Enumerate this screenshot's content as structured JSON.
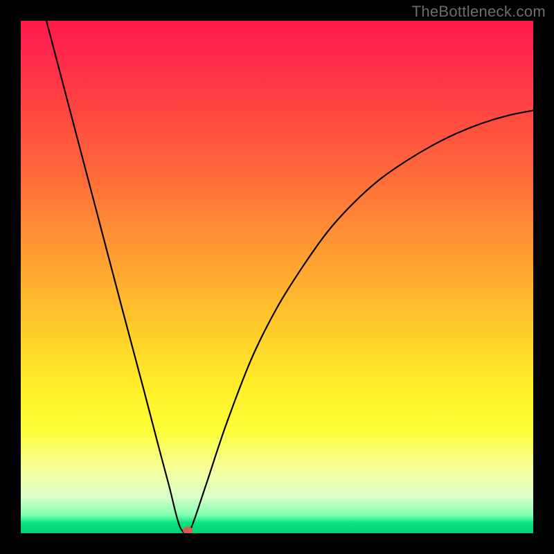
{
  "watermark": "TheBottleneck.com",
  "colors": {
    "background": "#000000",
    "watermark_text": "#6d6d6d",
    "curve": "#000000",
    "marker": "#d6604d",
    "gradient_top": "#ff1a4d",
    "gradient_bottom": "#00d27a"
  },
  "chart_data": {
    "type": "line",
    "title": "",
    "xlabel": "",
    "ylabel": "",
    "xlim": [
      0,
      100
    ],
    "ylim": [
      0,
      100
    ],
    "gradient_note": "vertical_red_to_green",
    "series": [
      {
        "name": "bottleneck-curve",
        "x": [
          5,
          10,
          15,
          20,
          24,
          27,
          29,
          30.5,
          31.5,
          33,
          36,
          40,
          45,
          50,
          55,
          60,
          65,
          70,
          75,
          80,
          85,
          90,
          95,
          100
        ],
        "y": [
          100,
          81,
          62,
          43,
          28,
          16.5,
          9,
          3,
          0.5,
          0.5,
          9,
          21,
          34,
          44,
          52,
          59,
          64.5,
          69,
          72.5,
          75.5,
          78,
          80,
          81.5,
          82.5
        ]
      }
    ],
    "marker": {
      "x": 32.5,
      "y": 0.5
    },
    "annotations": []
  }
}
